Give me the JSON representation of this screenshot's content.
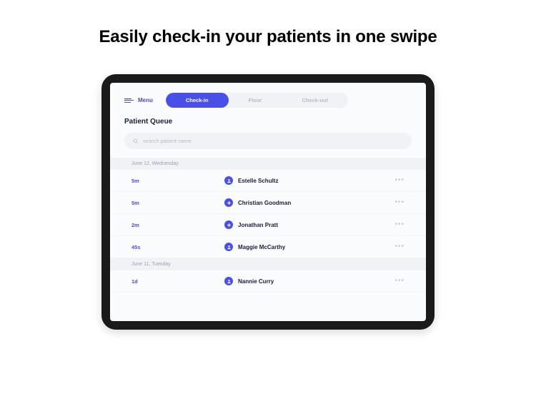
{
  "headline": "Easily check-in your patients in one swipe",
  "menu_label": "Menu",
  "tabs": {
    "checkin": "Check-in",
    "floor": "Floor",
    "checkout": "Check-out"
  },
  "section_title": "Patient Queue",
  "search": {
    "placeholder": "search patient name"
  },
  "groups": [
    {
      "date": "June 12, Wednesday",
      "rows": [
        {
          "time": "5m",
          "name": "Estelle Schultz",
          "icon": "person"
        },
        {
          "time": "5m",
          "name": "Christian Goodman",
          "icon": "plus"
        },
        {
          "time": "2m",
          "name": "Jonathan Pratt",
          "icon": "plus"
        },
        {
          "time": "45s",
          "name": "Maggie McCarthy",
          "icon": "person"
        }
      ]
    },
    {
      "date": "June 11, Tuesday",
      "rows": [
        {
          "time": "1d",
          "name": "Nannie Curry",
          "icon": "person"
        }
      ]
    }
  ]
}
